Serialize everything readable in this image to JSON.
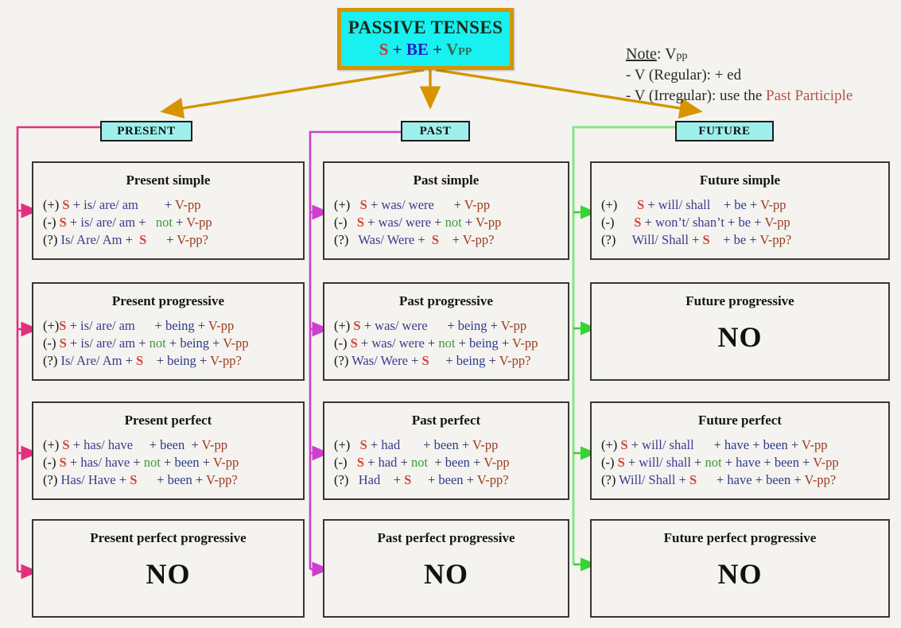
{
  "title": {
    "line1": "PASSIVE TENSES",
    "s": "S",
    "plus1": " + ",
    "be": "BE",
    "plus2": " + ",
    "v": "V",
    "pp": "PP"
  },
  "note": {
    "label": "Note",
    "colon": ": V",
    "sub": "pp",
    "line2": "- V (Regular):  + ed",
    "line3_a": "- V (Irregular): use the ",
    "line3_b": "Past Participle"
  },
  "columns": {
    "present": {
      "pill": "PRESENT",
      "accent": "#e0317f"
    },
    "past": {
      "pill": "PAST",
      "accent": "#cc3fcc"
    },
    "future": {
      "pill": "FUTURE",
      "accent": "#5ae25a"
    }
  },
  "cards": [
    {
      "id": "present-simple",
      "title": "Present simple",
      "lines": [
        [
          {
            "t": "(+) ",
            "c": "k-mark"
          },
          {
            "t": "S",
            "c": "k-s"
          },
          {
            "t": " + ",
            "c": "k-plus"
          },
          {
            "t": "is/ are/ am",
            "c": "k-aux"
          },
          {
            "t": "        + ",
            "c": "k-plus"
          },
          {
            "t": "V-pp",
            "c": "k-vpp"
          }
        ],
        [
          {
            "t": "(-) ",
            "c": "k-mark"
          },
          {
            "t": "S",
            "c": "k-s"
          },
          {
            "t": " + ",
            "c": "k-plus"
          },
          {
            "t": "is/ are/ am",
            "c": "k-aux"
          },
          {
            "t": " +   ",
            "c": "k-plus"
          },
          {
            "t": "not",
            "c": "k-not"
          },
          {
            "t": " + ",
            "c": "k-plus"
          },
          {
            "t": "V-pp",
            "c": "k-vpp"
          }
        ],
        [
          {
            "t": "(?) ",
            "c": "k-mark"
          },
          {
            "t": "Is/ Are/ Am",
            "c": "k-aux"
          },
          {
            "t": " +  ",
            "c": "k-plus"
          },
          {
            "t": "S",
            "c": "k-s"
          },
          {
            "t": "      + ",
            "c": "k-plus"
          },
          {
            "t": "V-pp?",
            "c": "k-vpp"
          }
        ]
      ],
      "no": null
    },
    {
      "id": "past-simple",
      "title": "Past simple",
      "lines": [
        [
          {
            "t": "(+)   ",
            "c": "k-mark"
          },
          {
            "t": "S",
            "c": "k-s"
          },
          {
            "t": " + ",
            "c": "k-plus"
          },
          {
            "t": "was/ were",
            "c": "k-aux"
          },
          {
            "t": "      + ",
            "c": "k-plus"
          },
          {
            "t": "V-pp",
            "c": "k-vpp"
          }
        ],
        [
          {
            "t": "(-)   ",
            "c": "k-mark"
          },
          {
            "t": "S",
            "c": "k-s"
          },
          {
            "t": " + ",
            "c": "k-plus"
          },
          {
            "t": "was/ were",
            "c": "k-aux"
          },
          {
            "t": " + ",
            "c": "k-plus"
          },
          {
            "t": "not",
            "c": "k-not"
          },
          {
            "t": " + ",
            "c": "k-plus"
          },
          {
            "t": "V-pp",
            "c": "k-vpp"
          }
        ],
        [
          {
            "t": "(?)   ",
            "c": "k-mark"
          },
          {
            "t": "Was/ Were",
            "c": "k-aux"
          },
          {
            "t": " +  ",
            "c": "k-plus"
          },
          {
            "t": "S",
            "c": "k-s"
          },
          {
            "t": "    + ",
            "c": "k-plus"
          },
          {
            "t": "V-pp?",
            "c": "k-vpp"
          }
        ]
      ],
      "no": null
    },
    {
      "id": "future-simple",
      "title": "Future simple",
      "lines": [
        [
          {
            "t": "(+)      ",
            "c": "k-mark"
          },
          {
            "t": "S",
            "c": "k-s"
          },
          {
            "t": " + ",
            "c": "k-plus"
          },
          {
            "t": "will/ shall",
            "c": "k-aux"
          },
          {
            "t": "    + ",
            "c": "k-plus"
          },
          {
            "t": "be",
            "c": "k-been"
          },
          {
            "t": " + ",
            "c": "k-plus"
          },
          {
            "t": "V-pp",
            "c": "k-vpp"
          }
        ],
        [
          {
            "t": "(-)      ",
            "c": "k-mark"
          },
          {
            "t": "S",
            "c": "k-s"
          },
          {
            "t": " + ",
            "c": "k-plus"
          },
          {
            "t": "won’t/ shan’t",
            "c": "k-aux"
          },
          {
            "t": " + ",
            "c": "k-plus"
          },
          {
            "t": "be",
            "c": "k-been"
          },
          {
            "t": " + ",
            "c": "k-plus"
          },
          {
            "t": "V-pp",
            "c": "k-vpp"
          }
        ],
        [
          {
            "t": "(?)     ",
            "c": "k-mark"
          },
          {
            "t": "Will/ Shall",
            "c": "k-aux"
          },
          {
            "t": " + ",
            "c": "k-plus"
          },
          {
            "t": "S",
            "c": "k-s"
          },
          {
            "t": "    + ",
            "c": "k-plus"
          },
          {
            "t": "be",
            "c": "k-been"
          },
          {
            "t": " + ",
            "c": "k-plus"
          },
          {
            "t": "V-pp?",
            "c": "k-vpp"
          }
        ]
      ],
      "no": null
    },
    {
      "id": "present-progressive",
      "title": "Present progressive",
      "lines": [
        [
          {
            "t": "(+)",
            "c": "k-mark"
          },
          {
            "t": "S",
            "c": "k-s"
          },
          {
            "t": " + ",
            "c": "k-plus"
          },
          {
            "t": "is/ are/ am",
            "c": "k-aux"
          },
          {
            "t": "      + ",
            "c": "k-plus"
          },
          {
            "t": "being",
            "c": "k-been"
          },
          {
            "t": " + ",
            "c": "k-plus"
          },
          {
            "t": "V-pp",
            "c": "k-vpp"
          }
        ],
        [
          {
            "t": "(-) ",
            "c": "k-mark"
          },
          {
            "t": "S",
            "c": "k-s"
          },
          {
            "t": " + ",
            "c": "k-plus"
          },
          {
            "t": "is/ are/ am",
            "c": "k-aux"
          },
          {
            "t": " + ",
            "c": "k-plus"
          },
          {
            "t": "not",
            "c": "k-not"
          },
          {
            "t": " + ",
            "c": "k-plus"
          },
          {
            "t": "being",
            "c": "k-been"
          },
          {
            "t": " + ",
            "c": "k-plus"
          },
          {
            "t": "V-pp",
            "c": "k-vpp"
          }
        ],
        [
          {
            "t": "(?) ",
            "c": "k-mark"
          },
          {
            "t": "Is/ Are/ Am",
            "c": "k-aux"
          },
          {
            "t": " + ",
            "c": "k-plus"
          },
          {
            "t": "S",
            "c": "k-s"
          },
          {
            "t": "    + ",
            "c": "k-plus"
          },
          {
            "t": "being",
            "c": "k-been"
          },
          {
            "t": " + ",
            "c": "k-plus"
          },
          {
            "t": "V-pp?",
            "c": "k-vpp"
          }
        ]
      ],
      "no": null
    },
    {
      "id": "past-progressive",
      "title": "Past progressive",
      "lines": [
        [
          {
            "t": "(+) ",
            "c": "k-mark"
          },
          {
            "t": "S",
            "c": "k-s"
          },
          {
            "t": " + ",
            "c": "k-plus"
          },
          {
            "t": "was/ were",
            "c": "k-aux"
          },
          {
            "t": "      + ",
            "c": "k-plus"
          },
          {
            "t": "being",
            "c": "k-been"
          },
          {
            "t": " + ",
            "c": "k-plus"
          },
          {
            "t": "V-pp",
            "c": "k-vpp"
          }
        ],
        [
          {
            "t": "(-) ",
            "c": "k-mark"
          },
          {
            "t": "S",
            "c": "k-s"
          },
          {
            "t": " + ",
            "c": "k-plus"
          },
          {
            "t": "was/ were",
            "c": "k-aux"
          },
          {
            "t": " + ",
            "c": "k-plus"
          },
          {
            "t": "not",
            "c": "k-not"
          },
          {
            "t": " + ",
            "c": "k-plus"
          },
          {
            "t": "being",
            "c": "k-been"
          },
          {
            "t": " + ",
            "c": "k-plus"
          },
          {
            "t": "V-pp",
            "c": "k-vpp"
          }
        ],
        [
          {
            "t": "(?) ",
            "c": "k-mark"
          },
          {
            "t": "Was/ Were",
            "c": "k-aux"
          },
          {
            "t": " + ",
            "c": "k-plus"
          },
          {
            "t": "S",
            "c": "k-s"
          },
          {
            "t": "     + ",
            "c": "k-plus"
          },
          {
            "t": "being",
            "c": "k-been"
          },
          {
            "t": " + ",
            "c": "k-plus"
          },
          {
            "t": "V-pp?",
            "c": "k-vpp"
          }
        ]
      ],
      "no": null
    },
    {
      "id": "future-progressive",
      "title": "Future progressive",
      "lines": [],
      "no": "NO"
    },
    {
      "id": "present-perfect",
      "title": "Present perfect",
      "lines": [
        [
          {
            "t": "(+) ",
            "c": "k-mark"
          },
          {
            "t": "S",
            "c": "k-s"
          },
          {
            "t": " + ",
            "c": "k-plus"
          },
          {
            "t": "has/ have",
            "c": "k-aux"
          },
          {
            "t": "     + ",
            "c": "k-plus"
          },
          {
            "t": "been",
            "c": "k-been"
          },
          {
            "t": "  + ",
            "c": "k-plus"
          },
          {
            "t": "V-pp",
            "c": "k-vpp"
          }
        ],
        [
          {
            "t": "(-) ",
            "c": "k-mark"
          },
          {
            "t": "S",
            "c": "k-s"
          },
          {
            "t": " + ",
            "c": "k-plus"
          },
          {
            "t": "has/ have",
            "c": "k-aux"
          },
          {
            "t": " + ",
            "c": "k-plus"
          },
          {
            "t": "not",
            "c": "k-not"
          },
          {
            "t": " + ",
            "c": "k-plus"
          },
          {
            "t": "been",
            "c": "k-been"
          },
          {
            "t": " + ",
            "c": "k-plus"
          },
          {
            "t": "V-pp",
            "c": "k-vpp"
          }
        ],
        [
          {
            "t": "(?) ",
            "c": "k-mark"
          },
          {
            "t": "Has/ Have",
            "c": "k-aux"
          },
          {
            "t": " + ",
            "c": "k-plus"
          },
          {
            "t": "S",
            "c": "k-s"
          },
          {
            "t": "      + ",
            "c": "k-plus"
          },
          {
            "t": "been",
            "c": "k-been"
          },
          {
            "t": " + ",
            "c": "k-plus"
          },
          {
            "t": "V-pp?",
            "c": "k-vpp"
          }
        ]
      ],
      "no": null
    },
    {
      "id": "past-perfect",
      "title": "Past perfect",
      "lines": [
        [
          {
            "t": "(+)   ",
            "c": "k-mark"
          },
          {
            "t": "S",
            "c": "k-s"
          },
          {
            "t": " + ",
            "c": "k-plus"
          },
          {
            "t": "had",
            "c": "k-aux"
          },
          {
            "t": "       + ",
            "c": "k-plus"
          },
          {
            "t": "been",
            "c": "k-been"
          },
          {
            "t": " + ",
            "c": "k-plus"
          },
          {
            "t": "V-pp",
            "c": "k-vpp"
          }
        ],
        [
          {
            "t": "(-)   ",
            "c": "k-mark"
          },
          {
            "t": "S",
            "c": "k-s"
          },
          {
            "t": " + ",
            "c": "k-plus"
          },
          {
            "t": "had",
            "c": "k-aux"
          },
          {
            "t": " + ",
            "c": "k-plus"
          },
          {
            "t": "not",
            "c": "k-not"
          },
          {
            "t": "  + ",
            "c": "k-plus"
          },
          {
            "t": "been",
            "c": "k-been"
          },
          {
            "t": " + ",
            "c": "k-plus"
          },
          {
            "t": "V-pp",
            "c": "k-vpp"
          }
        ],
        [
          {
            "t": "(?)   ",
            "c": "k-mark"
          },
          {
            "t": "Had",
            "c": "k-aux"
          },
          {
            "t": "    + ",
            "c": "k-plus"
          },
          {
            "t": "S",
            "c": "k-s"
          },
          {
            "t": "     + ",
            "c": "k-plus"
          },
          {
            "t": "been",
            "c": "k-been"
          },
          {
            "t": " + ",
            "c": "k-plus"
          },
          {
            "t": "V-pp?",
            "c": "k-vpp"
          }
        ]
      ],
      "no": null
    },
    {
      "id": "future-perfect",
      "title": "Future perfect",
      "lines": [
        [
          {
            "t": "(+) ",
            "c": "k-mark"
          },
          {
            "t": "S",
            "c": "k-s"
          },
          {
            "t": " + ",
            "c": "k-plus"
          },
          {
            "t": "will/ shall",
            "c": "k-aux"
          },
          {
            "t": "      + ",
            "c": "k-plus"
          },
          {
            "t": "have",
            "c": "k-been"
          },
          {
            "t": " + ",
            "c": "k-plus"
          },
          {
            "t": "been",
            "c": "k-been"
          },
          {
            "t": " + ",
            "c": "k-plus"
          },
          {
            "t": "V-pp",
            "c": "k-vpp"
          }
        ],
        [
          {
            "t": "(-) ",
            "c": "k-mark"
          },
          {
            "t": "S",
            "c": "k-s"
          },
          {
            "t": " + ",
            "c": "k-plus"
          },
          {
            "t": "will/ shall",
            "c": "k-aux"
          },
          {
            "t": " + ",
            "c": "k-plus"
          },
          {
            "t": "not",
            "c": "k-not"
          },
          {
            "t": " + ",
            "c": "k-plus"
          },
          {
            "t": "have",
            "c": "k-been"
          },
          {
            "t": " + ",
            "c": "k-plus"
          },
          {
            "t": "been",
            "c": "k-been"
          },
          {
            "t": " + ",
            "c": "k-plus"
          },
          {
            "t": "V-pp",
            "c": "k-vpp"
          }
        ],
        [
          {
            "t": "(?) ",
            "c": "k-mark"
          },
          {
            "t": "Will/ Shall",
            "c": "k-aux"
          },
          {
            "t": " + ",
            "c": "k-plus"
          },
          {
            "t": "S",
            "c": "k-s"
          },
          {
            "t": "      + ",
            "c": "k-plus"
          },
          {
            "t": "have",
            "c": "k-been"
          },
          {
            "t": " + ",
            "c": "k-plus"
          },
          {
            "t": "been",
            "c": "k-been"
          },
          {
            "t": " + ",
            "c": "k-plus"
          },
          {
            "t": "V-pp?",
            "c": "k-vpp"
          }
        ]
      ],
      "no": null
    },
    {
      "id": "present-perfect-progressive",
      "title": "Present perfect progressive",
      "lines": [],
      "no": "NO"
    },
    {
      "id": "past-perfect-progressive",
      "title": "Past perfect progressive",
      "lines": [],
      "no": "NO"
    },
    {
      "id": "future-perfect-progressive",
      "title": "Future perfect progressive",
      "lines": [],
      "no": "NO"
    }
  ]
}
